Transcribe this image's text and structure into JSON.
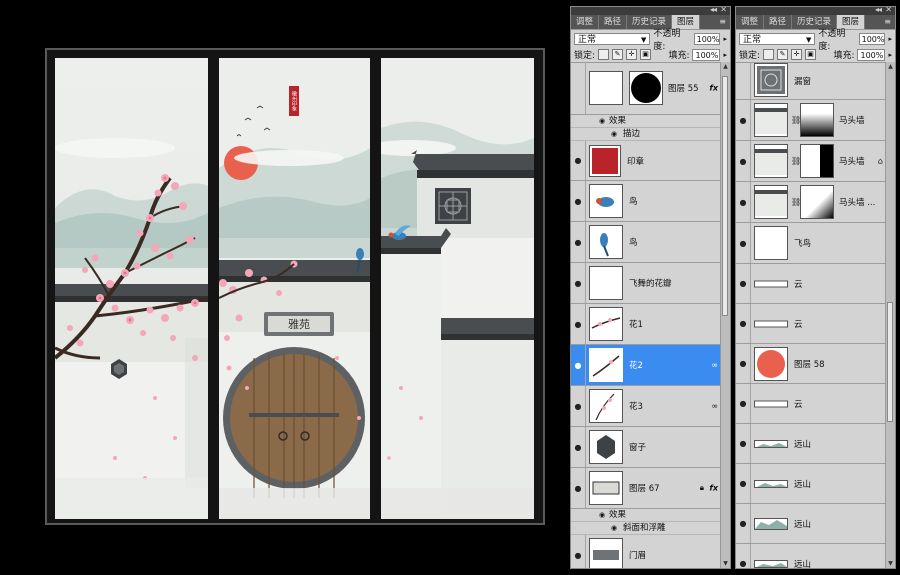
{
  "artwork": {
    "seal_text": "徽州印象",
    "plaque_text": "雅苑",
    "colors": {
      "sun": "#e9604f",
      "tile": "#4a4d4f",
      "wall": "#f1f2ef",
      "door": "#8a6a48",
      "blossom": "#f3a7b8",
      "mountain": "#a9c2bc",
      "sky": "#e8ebe6"
    }
  },
  "palette_left": {
    "tabs": [
      "调整",
      "路径",
      "历史记录",
      "图层"
    ],
    "active_tab": "图层",
    "blend_mode": "正常",
    "opacity_label": "不透明度:",
    "opacity_value": "100%",
    "lock_label": "锁定:",
    "fill_label": "填充:",
    "fill_value": "100%",
    "layers": [
      {
        "name": "图层 55",
        "visible": false,
        "thumb": "white-with-mask",
        "fx": "fx"
      },
      {
        "name": "效果",
        "kind": "effects-header"
      },
      {
        "name": "描边",
        "kind": "effect"
      },
      {
        "name": "印章",
        "visible": true,
        "thumb": "seal"
      },
      {
        "name": "鸟",
        "visible": true,
        "thumb": "bird"
      },
      {
        "name": "鸟",
        "visible": true,
        "thumb": "bird"
      },
      {
        "name": "飞舞的花瓣",
        "visible": true,
        "thumb": "checker"
      },
      {
        "name": "花1",
        "visible": true,
        "thumb": "branch"
      },
      {
        "name": "花2",
        "visible": true,
        "thumb": "branch",
        "selected": true,
        "linked": true
      },
      {
        "name": "花3",
        "visible": true,
        "thumb": "branch",
        "linked": true
      },
      {
        "name": "窗子",
        "visible": true,
        "thumb": "window"
      },
      {
        "name": "图层 67",
        "visible": true,
        "thumb": "plaque",
        "fx": "fx",
        "locked": true
      },
      {
        "name": "效果",
        "kind": "effects-header"
      },
      {
        "name": "斜面和浮雕",
        "kind": "effect"
      },
      {
        "name": "门眉",
        "visible": true,
        "thumb": "lintel"
      }
    ]
  },
  "palette_right": {
    "tabs": [
      "调整",
      "路径",
      "历史记录",
      "图层"
    ],
    "active_tab": "图层",
    "blend_mode": "正常",
    "opacity_label": "不透明度:",
    "opacity_value": "100%",
    "lock_label": "锁定:",
    "fill_label": "填充:",
    "fill_value": "100%",
    "layers": [
      {
        "name": "漏窗",
        "visible": false,
        "thumb": "window-pattern"
      },
      {
        "name": "马头墙",
        "visible": true,
        "thumb": "wall",
        "mask": "fade-down"
      },
      {
        "name": "马头墙",
        "visible": true,
        "thumb": "wall",
        "mask": "fade-right",
        "locked": true
      },
      {
        "name": "马头墙 ...",
        "visible": true,
        "thumb": "wall",
        "mask": "fade-corner"
      },
      {
        "name": "飞鸟",
        "visible": true,
        "thumb": "checker"
      },
      {
        "name": "云",
        "visible": true,
        "thumb": "cloud-strip"
      },
      {
        "name": "云",
        "visible": true,
        "thumb": "cloud-strip"
      },
      {
        "name": "图层 58",
        "visible": true,
        "thumb": "sun"
      },
      {
        "name": "云",
        "visible": true,
        "thumb": "cloud-strip"
      },
      {
        "name": "远山",
        "visible": true,
        "thumb": "mountain-strip"
      },
      {
        "name": "远山",
        "visible": true,
        "thumb": "mountain-strip"
      },
      {
        "name": "远山",
        "visible": true,
        "thumb": "mountain-strip"
      },
      {
        "name": "远山",
        "visible": true,
        "thumb": "mountain-strip"
      }
    ]
  }
}
